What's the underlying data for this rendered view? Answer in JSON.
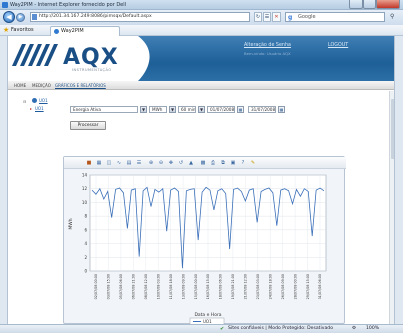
{
  "window": {
    "title": "Way2PIM - Internet Explorer fornecido por Dell"
  },
  "browser": {
    "url": "http://201.34.167.249:8086/pimsqx/Default.aspx",
    "search_placeholder": "Google",
    "favorites_label": "Favoritos",
    "tab_label": "Way2PIM"
  },
  "banner": {
    "logo": "AQX",
    "logo_sub": "INSTRUMENTAÇÃO",
    "change_password": "Alteração de Senha",
    "logout": "LOGOUT",
    "user_info": "Bem-vindo: Usuário AQX"
  },
  "menu": {
    "items": [
      "HOME",
      "MEDIÇÃO",
      "GRÁFICOS E RELATÓRIOS"
    ]
  },
  "tree": {
    "root": "UO1",
    "child": "UO1"
  },
  "filters": {
    "quantity": "Energia Ativa",
    "unit": "MWh",
    "interval": "60 min",
    "date_from": "01/07/2008",
    "date_to": "31/07/2008",
    "process_button": "Processar"
  },
  "chart_data": {
    "type": "line",
    "title": "",
    "xlabel": "Data e Hora",
    "ylabel": "MWh",
    "ylim": [
      0,
      14
    ],
    "yticks": [
      0,
      2,
      4,
      6,
      8,
      10,
      12,
      14
    ],
    "grid": true,
    "legend": "bottom",
    "categories": [
      "02/07/08 00:00",
      "03/07/08 15:00",
      "05/07/08 06:00",
      "06/07/08 21:00",
      "08/07/08 12:00",
      "10/07/08 03:00",
      "11/07/08 18:00",
      "13/07/08 09:00",
      "15/07/08 00:00",
      "16/07/08 15:00",
      "18/07/08 06:00",
      "19/07/08 21:00",
      "21/07/08 12:00",
      "23/07/08 03:00",
      "24/07/08 18:00",
      "26/07/08 09:00",
      "28/07/08 00:00",
      "29/07/08 15:00",
      "31/07/08 06:00"
    ],
    "series": [
      {
        "name": "UO1",
        "color": "#3a6fb8",
        "values": [
          11.8,
          11.2,
          12.0,
          10.5,
          11.6,
          7.8,
          11.9,
          12.1,
          11.4,
          6.2,
          11.8,
          12.0,
          2.1,
          11.7,
          12.2,
          9.4,
          11.9,
          11.5,
          12.0,
          5.8,
          11.8,
          12.1,
          11.6,
          0.4,
          11.7,
          11.9,
          12.0,
          4.5,
          11.5,
          12.2,
          11.8,
          8.9,
          11.7,
          12.0,
          11.3,
          3.2,
          11.9,
          12.1,
          11.6,
          10.2,
          11.8,
          12.0,
          7.1,
          11.6,
          11.9,
          12.1,
          11.4,
          6.6,
          11.8,
          12.0,
          11.7,
          9.8,
          11.9,
          10.9,
          12.0,
          11.6,
          5.1,
          11.8,
          12.1,
          11.7
        ]
      }
    ]
  },
  "status_bar": {
    "text": "Sites confiáveis | Modo Protegido: Desativado",
    "zoom": "100%"
  }
}
